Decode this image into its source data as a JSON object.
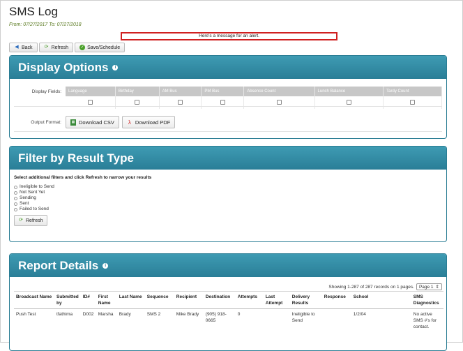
{
  "header": {
    "title": "SMS Log",
    "date_range": "From: 07/27/2017 To: 07/27/2018",
    "alert": "Here's a message for an alert."
  },
  "toolbar": {
    "back_label": "Back",
    "refresh_label": "Refresh",
    "save_label": "Save/Schedule"
  },
  "display_options": {
    "title": "Display Options",
    "fields_label": "Display Fields:",
    "fields": [
      "Language",
      "Birthday",
      "AM Bus",
      "PM Bus",
      "Absence Count",
      "Lunch Balance",
      "Tardy Count"
    ],
    "output_label": "Output Format:",
    "csv_label": "Download CSV",
    "pdf_label": "Download PDF"
  },
  "filter": {
    "title": "Filter by Result Type",
    "instructions": "Select additional filters and click Refresh to narrow your results",
    "options": [
      "Ineligible to Send",
      "Not Sent Yet",
      "Sending",
      "Sent",
      "Failed to Send"
    ],
    "refresh_label": "Refresh"
  },
  "report": {
    "title": "Report Details",
    "showing": "Showing 1-287 of 287 records on 1 pages.",
    "page_select": "Page 1",
    "columns": [
      "Broadcast Name",
      "Submitted by",
      "ID#",
      "First Name",
      "Last Name",
      "Sequence",
      "Recipient",
      "Destination",
      "Attempts",
      "Last Attempt",
      "Delivery Results",
      "Response",
      "School",
      "SMS Diagnostics"
    ],
    "rows": [
      [
        "Push Test",
        "tfathima",
        "D002",
        "Marsha",
        "Brady",
        "SMS 2",
        "Mike Brady",
        "(905) 918-0665",
        "0",
        "",
        "Ineligible to Send",
        "",
        "1/2/04",
        "No active SMS #'s for contact."
      ]
    ]
  },
  "colors": {
    "panel_header": "#2f8aa3",
    "alert_border": "#d02020",
    "date_text": "#5a7a20"
  }
}
